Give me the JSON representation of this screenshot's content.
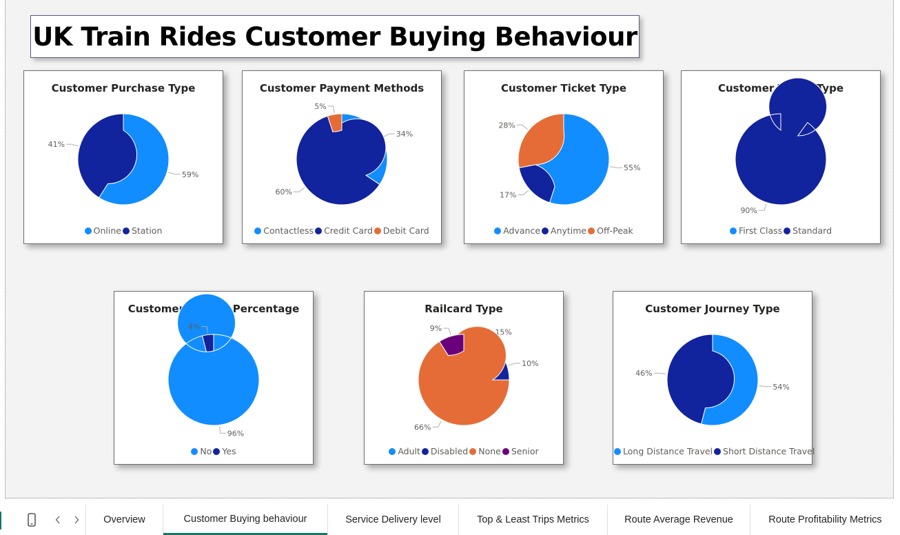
{
  "report": {
    "title": "UK Train Rides Customer Buying Behaviour"
  },
  "colors": {
    "light_blue": "#118DFF",
    "dark_blue": "#12239E",
    "orange": "#E66C37",
    "purple": "#6B007B",
    "tab_accent": "#117865"
  },
  "chart_data": [
    {
      "type": "donut",
      "title": "Customer Purchase Type",
      "categories": [
        "Online",
        "Station"
      ],
      "values": [
        59,
        41
      ],
      "labels": [
        "59%",
        "41%"
      ],
      "colors": [
        "#118DFF",
        "#12239E"
      ],
      "legend": "bottom"
    },
    {
      "type": "donut",
      "title": "Customer Payment Methods",
      "categories": [
        "Contactless",
        "Credit Card",
        "Debit Card"
      ],
      "values": [
        34,
        60,
        5
      ],
      "labels": [
        "34%",
        "60%",
        "5%"
      ],
      "colors": [
        "#118DFF",
        "#12239E",
        "#E66C37"
      ],
      "legend": "bottom"
    },
    {
      "type": "donut",
      "title": "Customer Ticket Type",
      "categories": [
        "Advance",
        "Anytime",
        "Off-Peak"
      ],
      "values": [
        55,
        17,
        28
      ],
      "labels": [
        "55%",
        "17%",
        "28%"
      ],
      "colors": [
        "#118DFF",
        "#12239E",
        "#E66C37"
      ],
      "legend": "bottom"
    },
    {
      "type": "donut",
      "title": "Customer Ticket Type",
      "categories": [
        "First Class",
        "Standard"
      ],
      "values": [
        10,
        90
      ],
      "labels": [
        "10%",
        "90%"
      ],
      "colors": [
        "#118DFF",
        "#12239E"
      ],
      "legend": "bottom"
    },
    {
      "type": "donut",
      "title": "Customer Refund Percentage",
      "categories": [
        "No",
        "Yes"
      ],
      "values": [
        96,
        4
      ],
      "labels": [
        "96%",
        "4%"
      ],
      "colors": [
        "#118DFF",
        "#12239E"
      ],
      "legend": "bottom"
    },
    {
      "type": "donut",
      "title": "Railcard Type",
      "categories": [
        "Adult",
        "Disabled",
        "None",
        "Senior"
      ],
      "values": [
        15,
        10,
        66,
        9
      ],
      "labels": [
        "15%",
        "10%",
        "66%",
        "9%"
      ],
      "colors": [
        "#118DFF",
        "#12239E",
        "#E66C37",
        "#6B007B"
      ],
      "legend": "bottom"
    },
    {
      "type": "donut",
      "title": "Customer Journey Type",
      "categories": [
        "Long Distance Travel",
        "Short Distance Travel"
      ],
      "values": [
        54,
        46
      ],
      "labels": [
        "54%",
        "46%"
      ],
      "colors": [
        "#118DFF",
        "#12239E"
      ],
      "legend": "bottom"
    }
  ],
  "tabs": [
    {
      "label": "Overview",
      "active": false
    },
    {
      "label": "Customer Buying behaviour",
      "active": true
    },
    {
      "label": "Service Delivery level",
      "active": false
    },
    {
      "label": "Top & Least Trips Metrics",
      "active": false
    },
    {
      "label": "Route Average Revenue",
      "active": false
    },
    {
      "label": "Route Profitability Metrics",
      "active": false
    }
  ],
  "tabbar_icons": [
    "mobile-layout-icon",
    "previous-page-icon",
    "next-page-icon"
  ]
}
